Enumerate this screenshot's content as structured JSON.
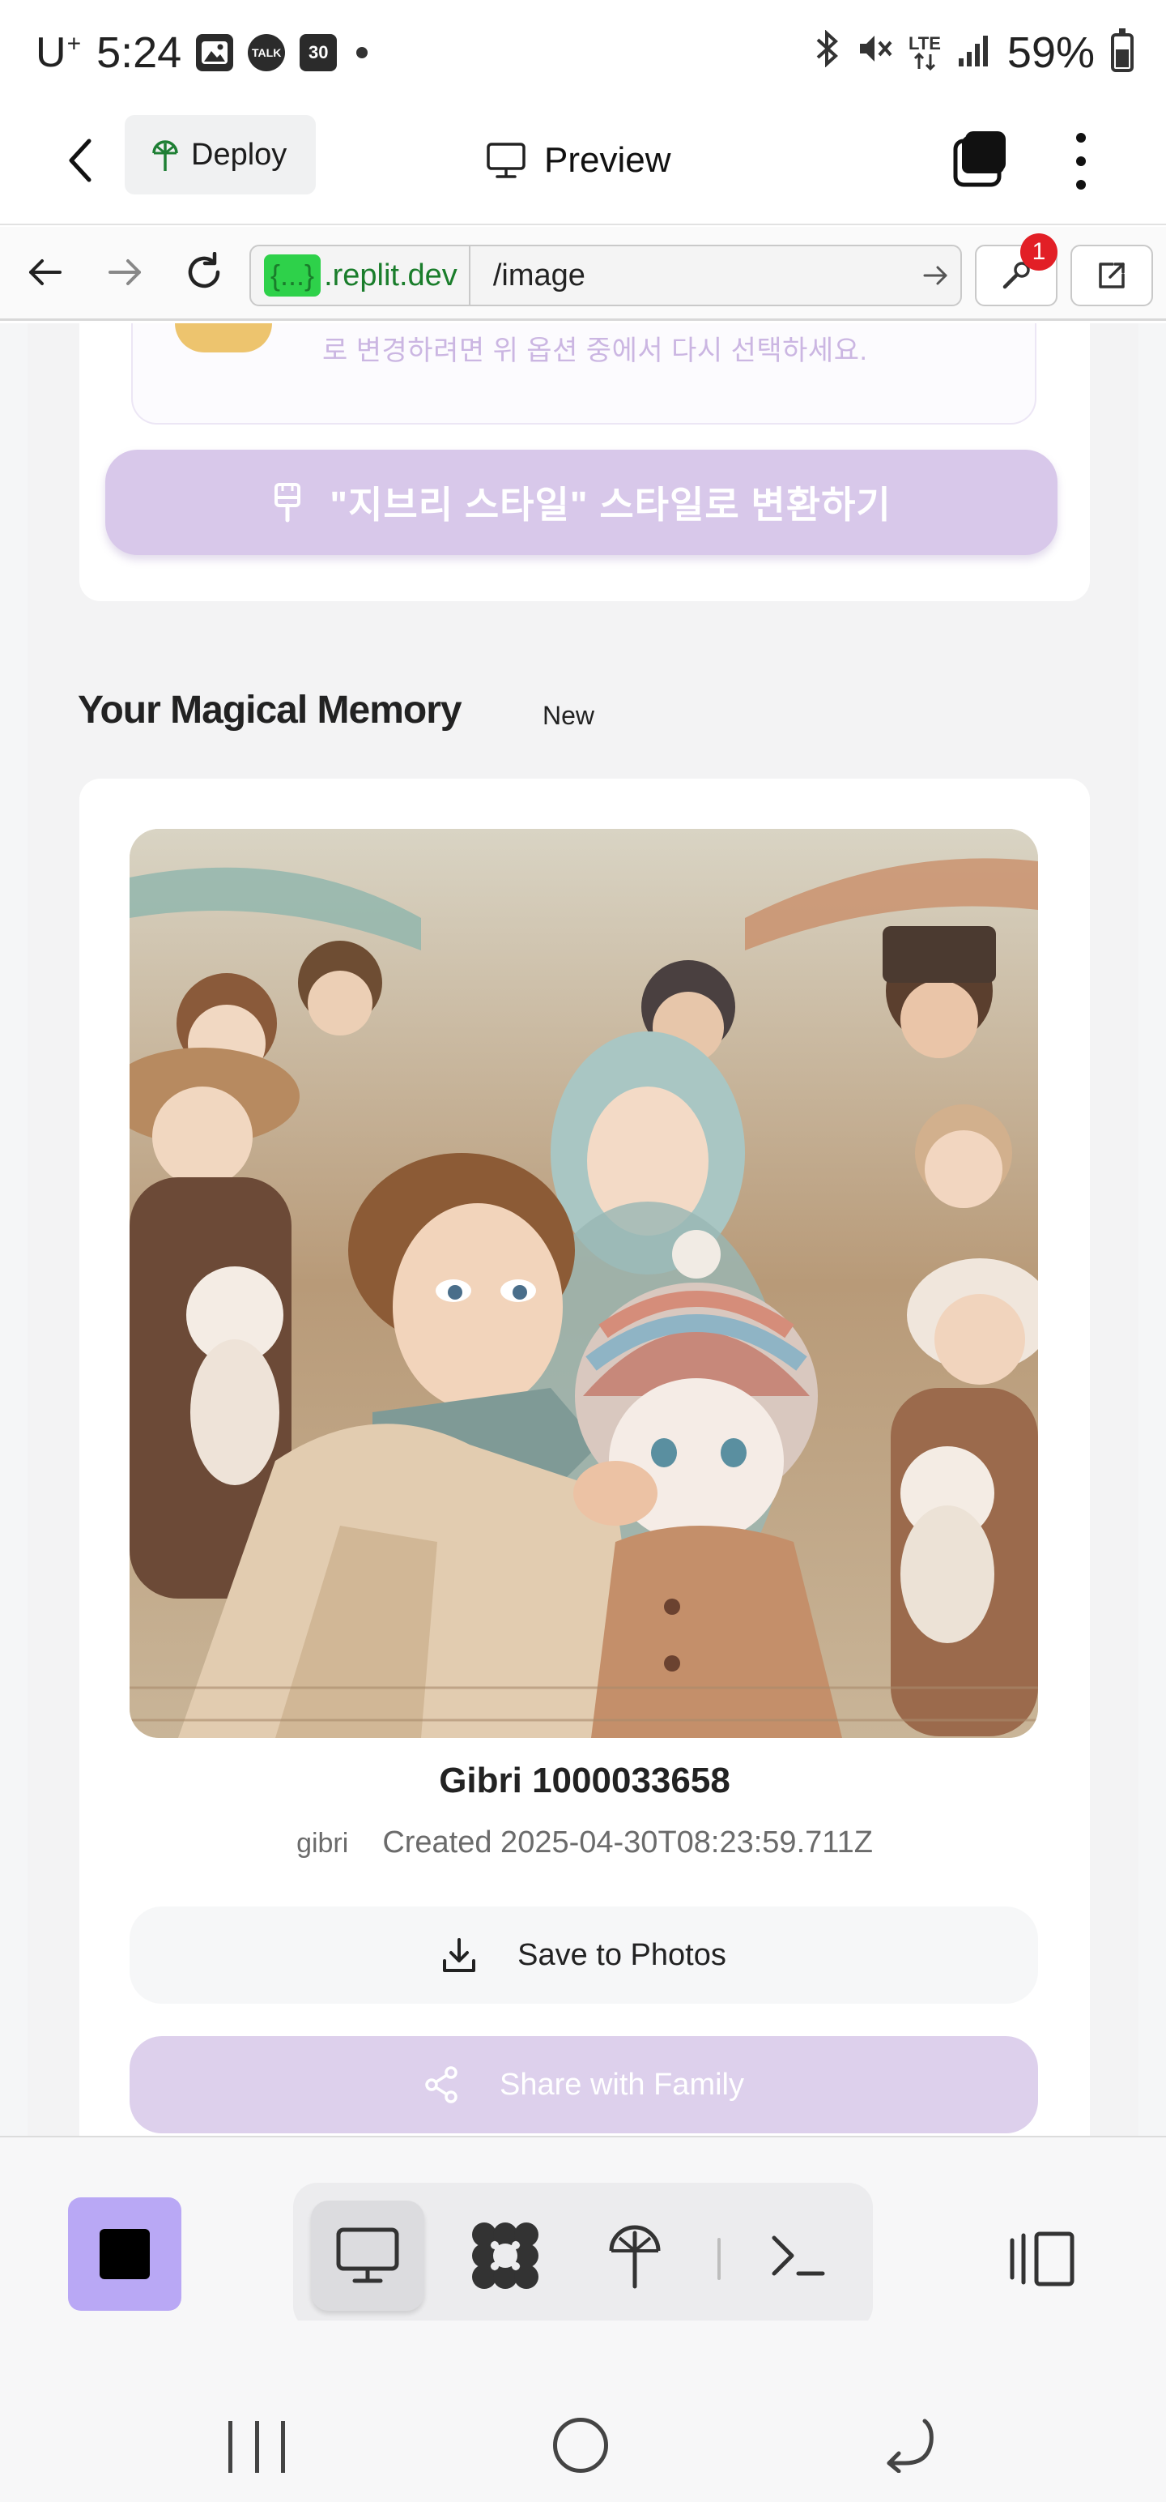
{
  "status_bar": {
    "carrier": "U",
    "carrier_suffix": "+",
    "time": "5:24",
    "calendar_day": "30",
    "chat_icon_text": "TALK",
    "network": "LTE",
    "battery": "59%",
    "icons": [
      "gallery-icon",
      "kakaotalk-icon",
      "calendar-icon",
      "bluetooth-icon",
      "mute-icon",
      "lte-icon",
      "signal-icon",
      "battery-icon"
    ]
  },
  "header": {
    "deploy_label": "Deploy",
    "preview_label": "Preview"
  },
  "browser": {
    "domain_chip": "{...}",
    "domain": ".replit.dev",
    "path": "/image",
    "notification_count": "1"
  },
  "page": {
    "info_text": "로 변경하려면 위 옵션 중에서 다시 선택하세요.",
    "convert_button": "\"지브리 스타일\" 스타일로 변환하기",
    "section_title": "Your Magical Memory",
    "section_badge": "New",
    "memory": {
      "name": "Gibri 1000033658",
      "tag": "gibri",
      "created": "Created 2025-04-30T08:23:59.711Z"
    },
    "save_button": "Save to Photos",
    "share_button": "Share with Family"
  },
  "colors": {
    "accent_purple": "#d8c8ea",
    "stop_button": "#b9a8f5",
    "domain_green": "#2ed14a",
    "badge_red": "#e21f26"
  }
}
